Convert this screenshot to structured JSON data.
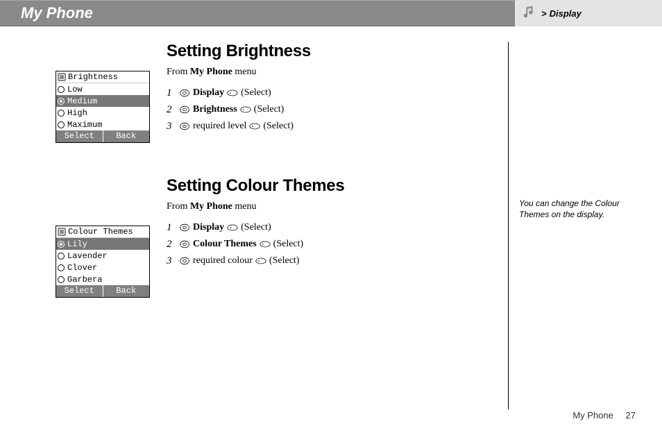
{
  "header": {
    "title": "My Phone"
  },
  "breadcrumb": {
    "gt": ">",
    "label": "Display"
  },
  "screens": {
    "brightness": {
      "title": "Brightness",
      "rows": [
        {
          "label": "Low",
          "selected": false
        },
        {
          "label": "Medium",
          "selected": true
        },
        {
          "label": "High",
          "selected": false
        },
        {
          "label": "Maximum",
          "selected": false
        }
      ],
      "softkeys": {
        "left": "Select",
        "right": "Back"
      }
    },
    "themes": {
      "title": "Colour Themes",
      "rows": [
        {
          "label": "Lily",
          "selected": true
        },
        {
          "label": "Lavender",
          "selected": false
        },
        {
          "label": "Clover",
          "selected": false
        },
        {
          "label": "Garbera",
          "selected": false
        }
      ],
      "softkeys": {
        "left": "Select",
        "right": "Back"
      }
    }
  },
  "sections": {
    "brightness": {
      "heading": "Setting Brightness",
      "from_prefix": "From ",
      "from_bold": "My Phone",
      "from_suffix": " menu",
      "steps": [
        {
          "num": "1",
          "bold": "Display",
          "tail": "(Select)"
        },
        {
          "num": "2",
          "bold": "Brightness",
          "tail": "(Select)"
        },
        {
          "num": "3",
          "plain": "required level",
          "tail": "(Select)"
        }
      ]
    },
    "themes": {
      "heading": "Setting Colour Themes",
      "from_prefix": "From ",
      "from_bold": "My Phone",
      "from_suffix": " menu",
      "steps": [
        {
          "num": "1",
          "bold": "Display",
          "tail": "(Select)"
        },
        {
          "num": "2",
          "bold": "Colour Themes",
          "tail": "(Select)"
        },
        {
          "num": "3",
          "plain": "required colour",
          "tail": "(Select)"
        }
      ]
    }
  },
  "sidenote": "You can change the Colour Themes on the display.",
  "footer": {
    "section": "My Phone",
    "page": "27"
  }
}
